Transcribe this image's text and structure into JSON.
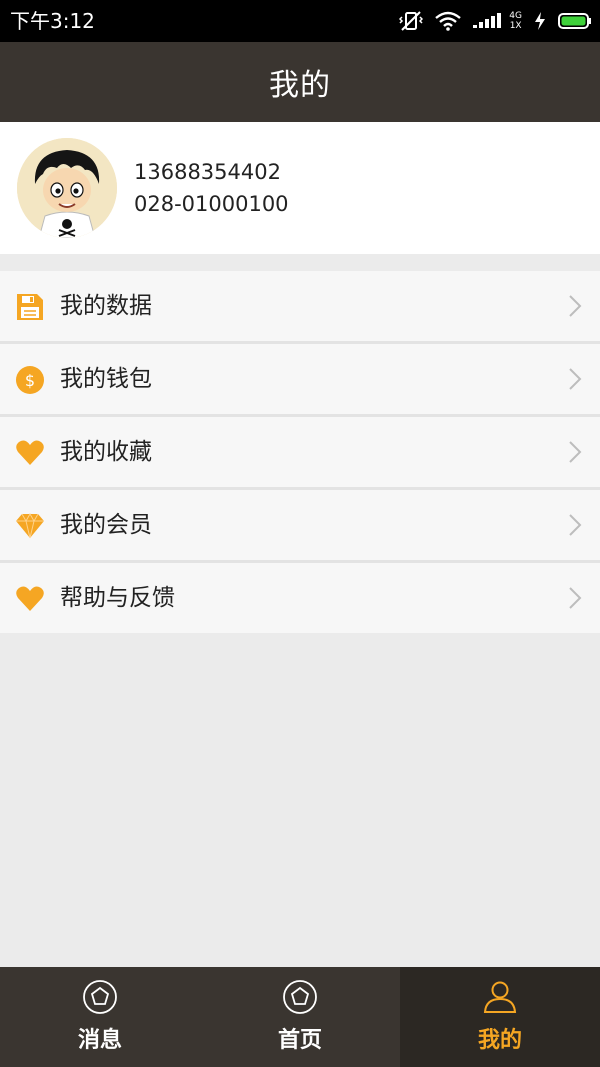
{
  "status_bar": {
    "time": "下午3:12",
    "network_top": "4G",
    "network_bottom": "1X"
  },
  "header": {
    "title": "我的"
  },
  "profile": {
    "phone": "13688354402",
    "tel": "028-01000100"
  },
  "menu": {
    "items": [
      {
        "label": "我的数据",
        "icon": "data-icon"
      },
      {
        "label": "我的钱包",
        "icon": "wallet-icon"
      },
      {
        "label": "我的收藏",
        "icon": "heart-icon"
      },
      {
        "label": "我的会员",
        "icon": "diamond-icon"
      },
      {
        "label": "帮助与反馈",
        "icon": "heart-icon"
      }
    ]
  },
  "tabs": [
    {
      "label": "消息",
      "icon": "pentagon-icon",
      "active": false
    },
    {
      "label": "首页",
      "icon": "pentagon-icon",
      "active": false
    },
    {
      "label": "我的",
      "icon": "user-icon",
      "active": true
    }
  ],
  "colors": {
    "accent": "#f5a623",
    "header_bg": "#3a3530",
    "tab_bar_bg": "#3a3530",
    "tab_active_bg": "#2c2823",
    "page_bg": "#ebebeb"
  }
}
